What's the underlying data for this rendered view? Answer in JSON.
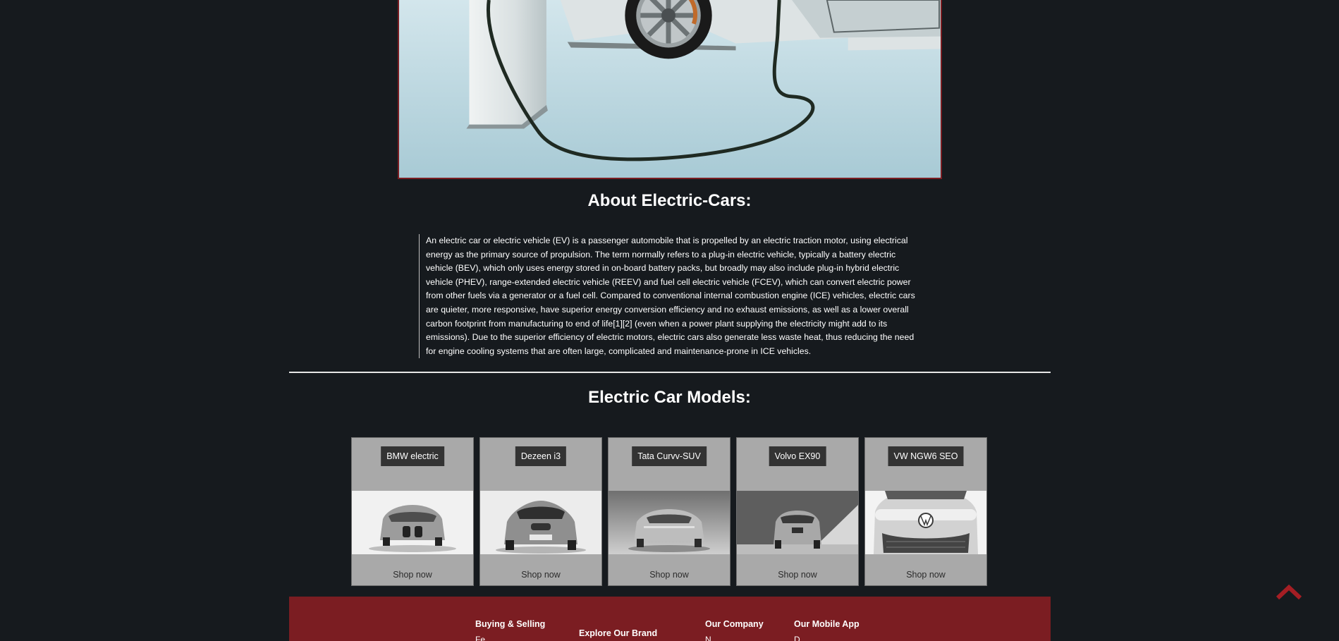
{
  "hero": {
    "alt": "Electric car charging"
  },
  "about": {
    "title": "About Electric-Cars:",
    "text": "An electric car or electric vehicle (EV) is a passenger automobile that is propelled by an electric traction motor, using electrical energy as the primary source of propulsion. The term normally refers to a plug-in electric vehicle, typically a battery electric vehicle (BEV), which only uses energy stored in on-board battery packs, but broadly may also include plug-in hybrid electric vehicle (PHEV), range-extended electric vehicle (REEV) and fuel cell electric vehicle (FCEV), which can convert electric power from other fuels via a generator or a fuel cell. Compared to conventional internal combustion engine (ICE) vehicles, electric cars are quieter, more responsive, have superior energy conversion efficiency and no exhaust emissions, as well as a lower overall carbon footprint from manufacturing to end of life[1][2] (even when a power plant supplying the electricity might add to its emissions). Due to the superior efficiency of electric motors, electric cars also generate less waste heat, thus reducing the need for engine cooling systems that are often large, complicated and maintenance-prone in ICE vehicles."
  },
  "models": {
    "title": "Electric Car Models:",
    "items": [
      {
        "name": "BMW electric",
        "cta": "Shop now"
      },
      {
        "name": "Dezeen i3",
        "cta": "Shop now"
      },
      {
        "name": "Tata Curvv-SUV",
        "cta": "Shop now"
      },
      {
        "name": "Volvo EX90",
        "cta": "Shop now"
      },
      {
        "name": "VW NGW6 SEO",
        "cta": "Shop now"
      }
    ]
  },
  "back_to_top_icon": "chevron-up-icon",
  "footer": {
    "columns": [
      {
        "title": "Buying & Selling",
        "sub": "Fe..."
      },
      {
        "title": "Explore Our Brand",
        "sub": ""
      },
      {
        "title": "Our Company",
        "sub": "N..."
      },
      {
        "title": "Our Mobile App",
        "sub": "D..."
      }
    ]
  },
  "colors": {
    "background": "#161a1e",
    "accent": "#7b1d22",
    "card": "#a9a9a9",
    "tag": "#333333"
  }
}
